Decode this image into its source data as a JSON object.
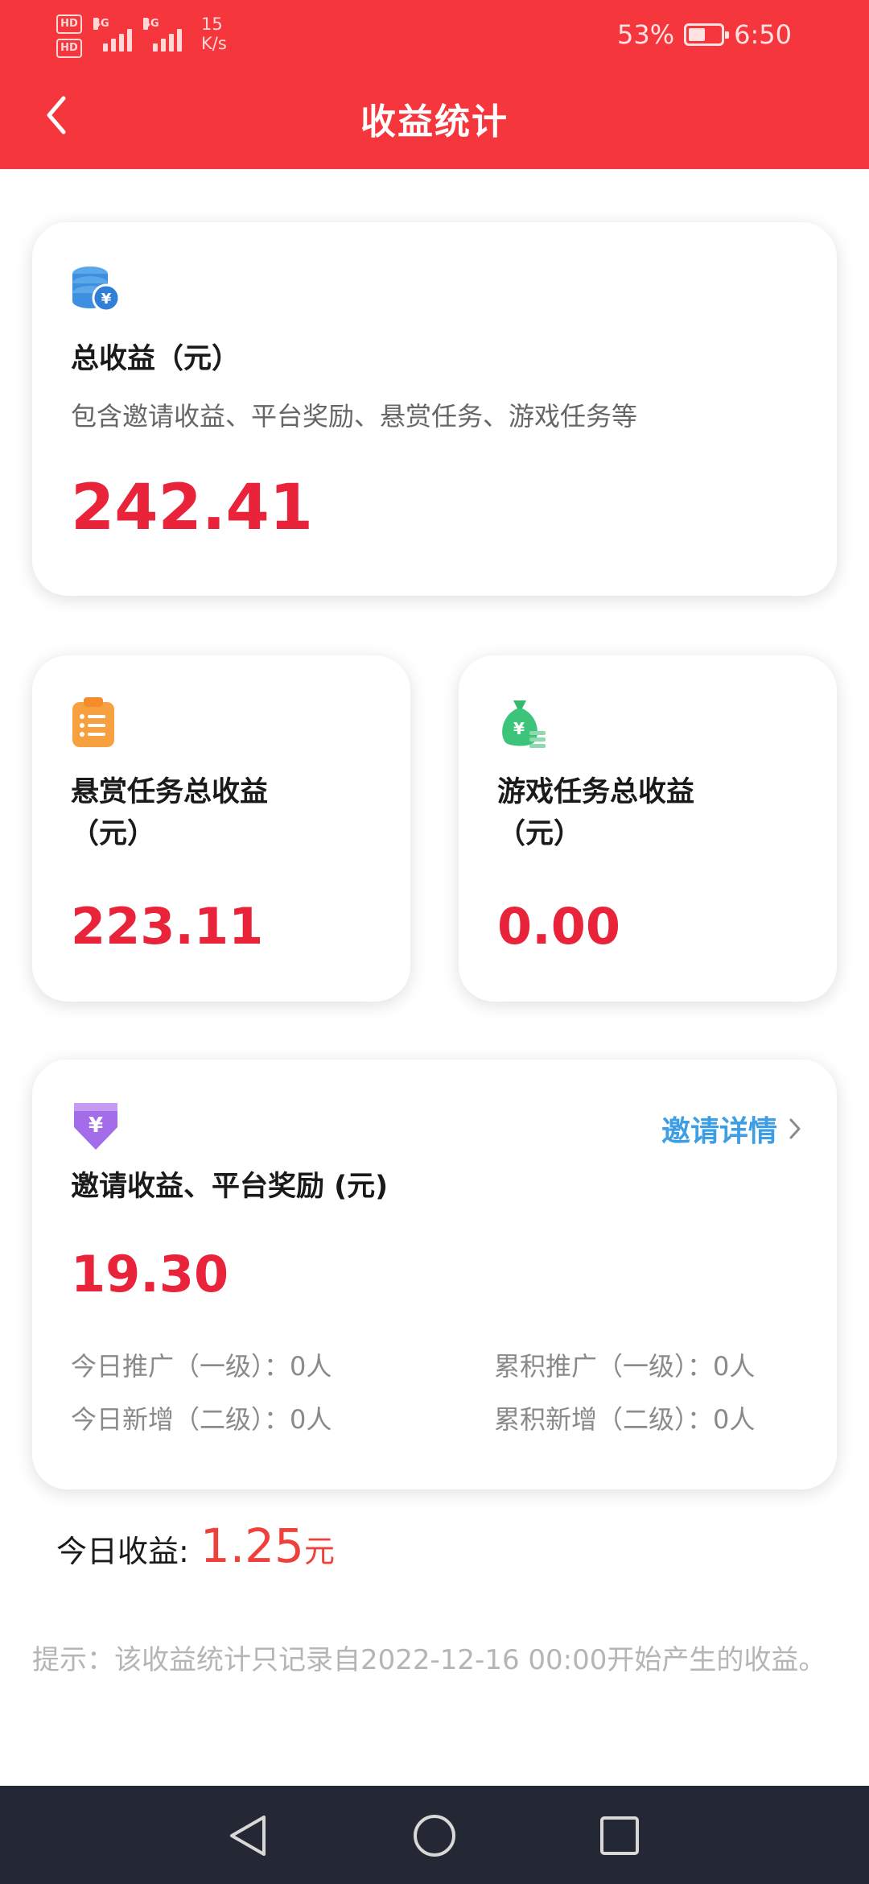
{
  "status_bar": {
    "hd1": "HD",
    "hd2": "HD",
    "net1": "4G",
    "net2": "4G",
    "speed_value": "15",
    "speed_unit": "K/s",
    "battery": "53%",
    "battery_level": 0.53,
    "time": "6:50"
  },
  "header": {
    "title": "收益统计"
  },
  "total_card": {
    "title": "总收益（元）",
    "subtitle": "包含邀请收益、平台奖励、悬赏任务、游戏任务等",
    "amount": "242.41"
  },
  "bounty_card": {
    "title_line1": "悬赏任务总收益",
    "title_line2": "（元）",
    "amount": "223.11"
  },
  "game_card": {
    "title_line1": "游戏任务总收益",
    "title_line2": "（元）",
    "amount": "0.00"
  },
  "invite_card": {
    "link_label": "邀请详情",
    "title": "邀请收益、平台奖励 (元)",
    "amount": "19.30",
    "stats": {
      "today_promote": "今日推广（一级）：0人",
      "total_promote": "累积推广（一级）：0人",
      "today_new": "今日新增（二级）：0人",
      "total_new": "累积新增（二级）：0人"
    }
  },
  "today_earnings": {
    "label": "今日收益:",
    "value": "1.25",
    "unit": "元"
  },
  "tip": "提示：该收益统计只记录自2022-12-16 00:00开始产生的收益。",
  "icons": {
    "back": "back-arrow-icon",
    "total": "coin-stack-yen-icon",
    "bounty": "clipboard-list-icon",
    "game": "money-bag-yen-icon",
    "invite": "yen-down-arrow-icon",
    "link": "chevron-right-icon"
  },
  "colors": {
    "header": "#f5373d",
    "amount": "#e8233a",
    "link": "#3d9ee4",
    "navbar": "#232834"
  }
}
